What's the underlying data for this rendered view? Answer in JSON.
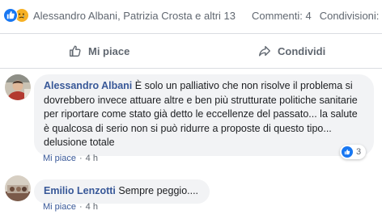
{
  "reactions": {
    "icons": [
      "like-icon",
      "sad-icon"
    ],
    "reactors": "Alessandro Albani, Patrizia Crosta e altri 13",
    "comments": "Commenti: 4",
    "shares": "Condivisioni: 1"
  },
  "actions": {
    "like_label": "Mi piace",
    "share_label": "Condividi"
  },
  "comments": [
    {
      "author": "Alessandro Albani",
      "text": " È solo un palliativo che non risolve il problema si dovrebbero invece attuare altre e ben più strutturate politiche sanitarie per riportare come stato già detto le eccellenze del passato... la salute è qualcosa di serio non si può ridurre a proposte di questo tipo... delusione totale",
      "like_label": "Mi piace",
      "time": "4 h",
      "like_count": "3"
    },
    {
      "author": "Emilio Lenzotti",
      "text": " Sempre peggio....",
      "like_label": "Mi piace",
      "time": "4 h"
    }
  ],
  "colors": {
    "facebook_blue": "#1877f2",
    "author_link": "#385898",
    "bubble_bg": "#f2f3f5",
    "meta_text": "#606770"
  }
}
